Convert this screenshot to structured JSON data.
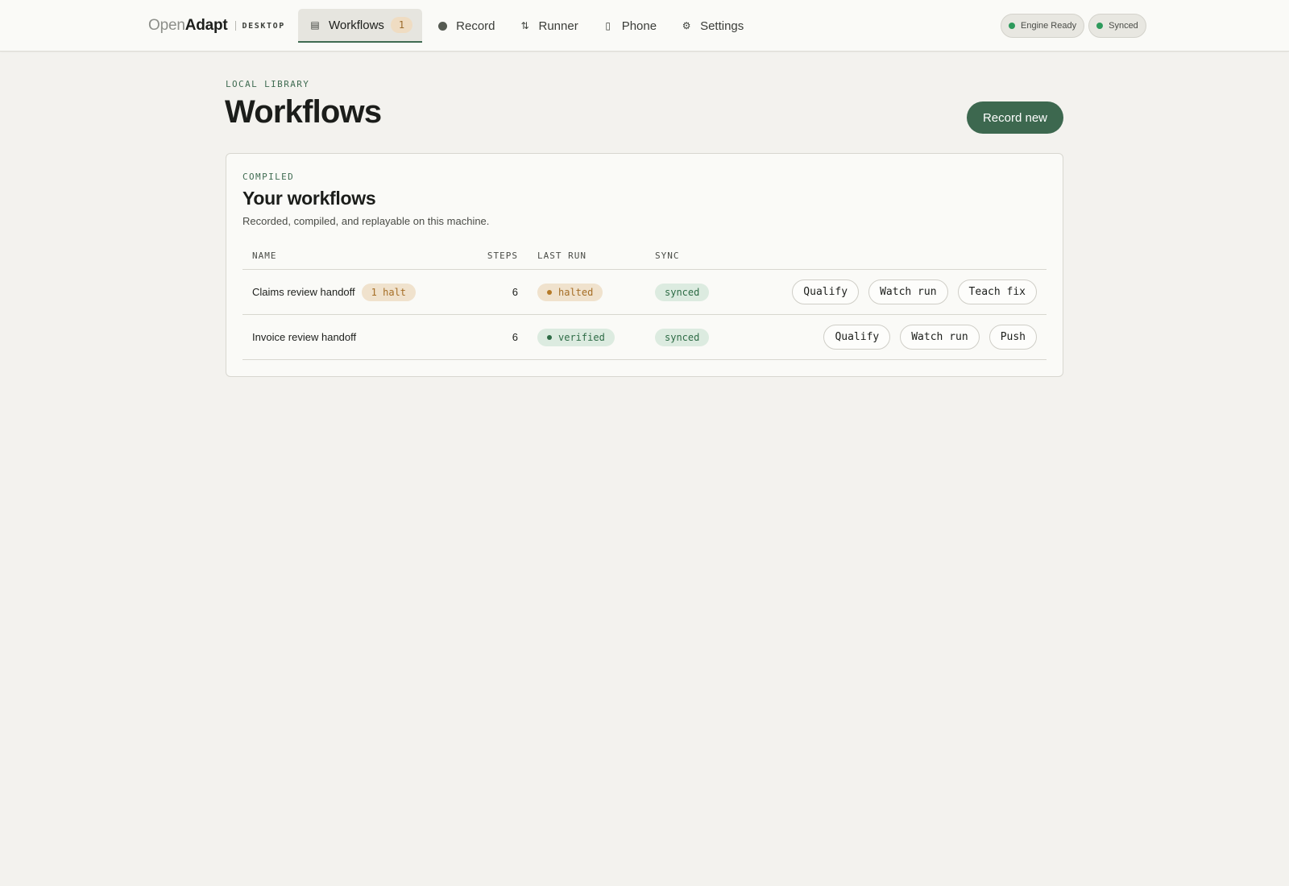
{
  "brand": {
    "open": "Open",
    "adapt": "Adapt",
    "sub": "DESKTOP"
  },
  "nav": {
    "items": [
      {
        "label": "Workflows",
        "icon": "list-icon",
        "glyph": "▤",
        "badge": "1",
        "active": true
      },
      {
        "label": "Record",
        "icon": "record-dot-icon",
        "glyph": "",
        "active": false
      },
      {
        "label": "Runner",
        "icon": "swap-arrows-icon",
        "glyph": "⇅",
        "active": false
      },
      {
        "label": "Phone",
        "icon": "phone-icon",
        "glyph": "▯",
        "active": false
      },
      {
        "label": "Settings",
        "icon": "gear-icon",
        "glyph": "⚙",
        "active": false
      }
    ]
  },
  "status": [
    {
      "label": "Engine Ready",
      "color": "#2e9a5c"
    },
    {
      "label": "Synced",
      "color": "#2e9a5c"
    }
  ],
  "page": {
    "eyebrow": "LOCAL LIBRARY",
    "title": "Workflows",
    "record_button": "Record new"
  },
  "card": {
    "eyebrow": "COMPILED",
    "title": "Your workflows",
    "subtitle": "Recorded, compiled, and replayable on this machine.",
    "columns": [
      "NAME",
      "STEPS",
      "LAST RUN",
      "SYNC"
    ],
    "rows": [
      {
        "name": "Claims review handoff",
        "halt_badge": "1 halt",
        "steps": "6",
        "last_run": "halted",
        "last_run_status": "halted",
        "sync": "synced",
        "actions": [
          "Qualify",
          "Watch run",
          "Teach fix"
        ]
      },
      {
        "name": "Invoice review handoff",
        "halt_badge": null,
        "steps": "6",
        "last_run": "verified",
        "last_run_status": "verified",
        "sync": "synced",
        "actions": [
          "Qualify",
          "Watch run",
          "Push"
        ]
      }
    ]
  },
  "colors": {
    "accent": "#3d684f",
    "halt": "#a56e26",
    "ok": "#2d6b45",
    "background": "#f3f2ee"
  }
}
